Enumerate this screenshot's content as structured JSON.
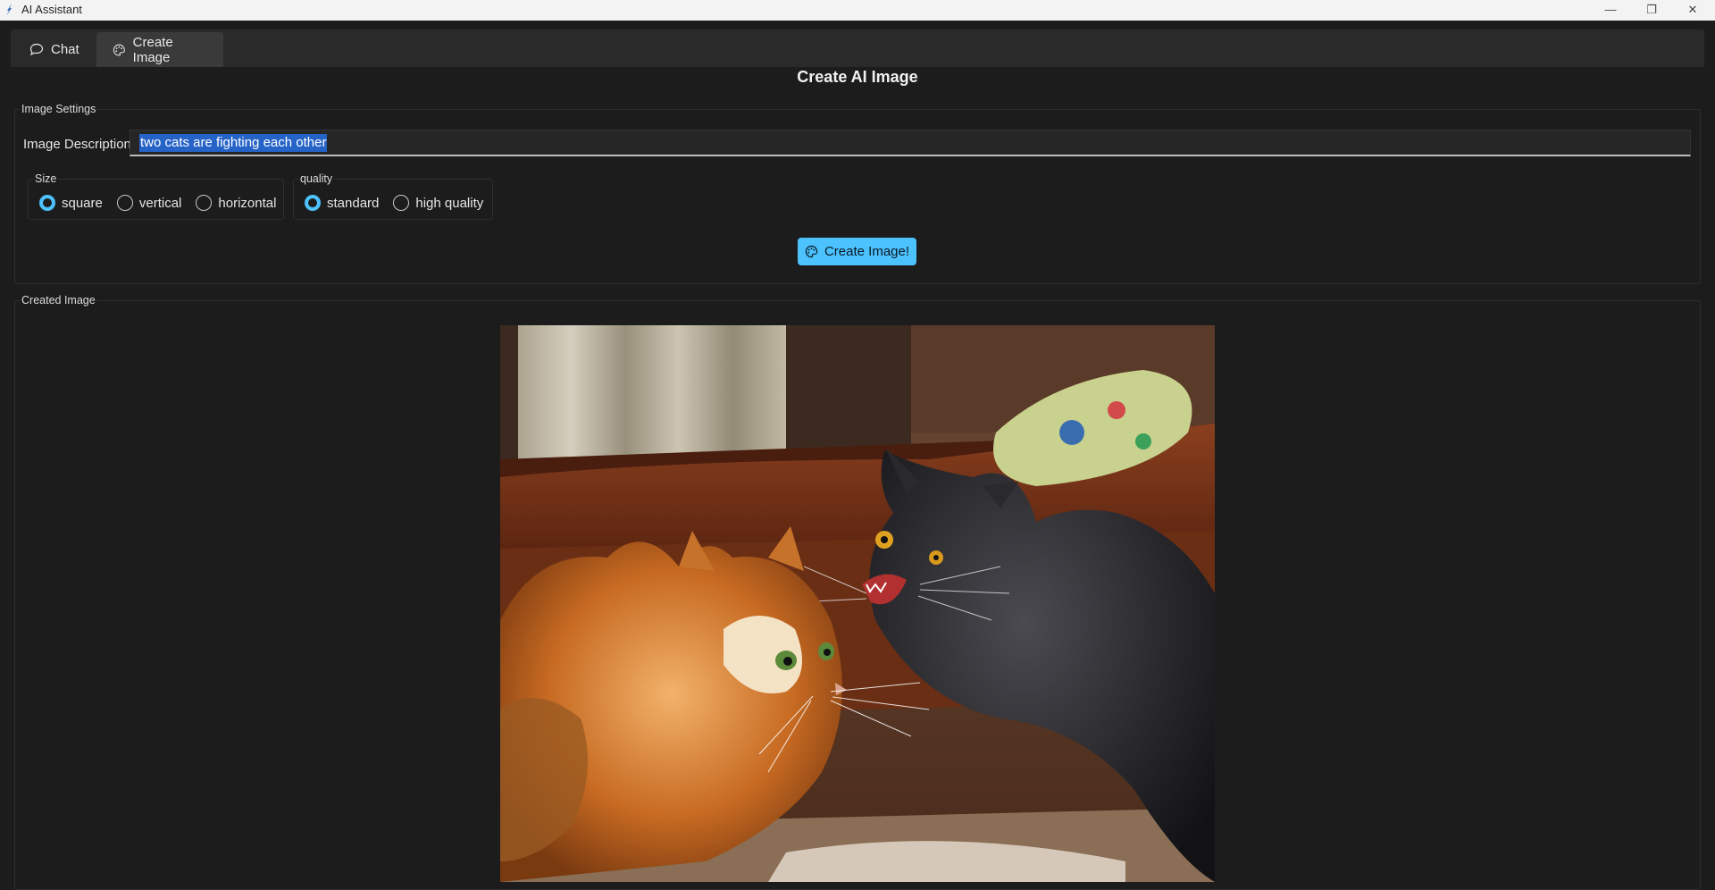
{
  "window": {
    "title": "AI Assistant",
    "controls": {
      "minimize": "—",
      "maximize": "❐",
      "close": "✕"
    }
  },
  "tabs": [
    {
      "label": "Chat",
      "icon": "chat-bubble-icon",
      "active": false
    },
    {
      "label": "Create Image",
      "icon": "palette-icon",
      "active": true
    }
  ],
  "page": {
    "title": "Create AI Image"
  },
  "settings": {
    "group_label": "Image Settings",
    "description_label": "Image Description:",
    "description_value": "two cats are fighting each other",
    "size": {
      "label": "Size",
      "options": [
        "square",
        "vertical",
        "horizontal"
      ],
      "selected": "square"
    },
    "quality": {
      "label": "quality",
      "options": [
        "standard",
        "high quality"
      ],
      "selected": "standard"
    },
    "create_button": "Create Image!"
  },
  "result": {
    "group_label": "Created Image",
    "image_description": "two cats are fighting each other"
  },
  "colors": {
    "accent": "#4cc2ff",
    "selection": "#2563c7",
    "background": "#1c1c1c",
    "tab_bar": "#2a2a2a",
    "active_tab": "#3a3a3a"
  }
}
